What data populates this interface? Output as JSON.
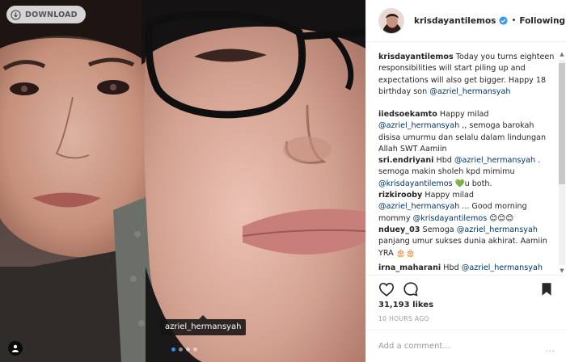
{
  "photo": {
    "download_label": "DOWNLOAD",
    "tag_username": "azriel_hermansyah",
    "carousel": {
      "count": 4,
      "active": 1
    }
  },
  "header": {
    "username": "krisdayantilemos",
    "verified": true,
    "follow_status": "Following"
  },
  "comments": [
    {
      "user": "krisdayantilemos",
      "parts": [
        {
          "t": " Today you turns eighteen responsibilities will start piling up and expectations will also get bigger. Happy 18 birthday son "
        },
        {
          "m": "@azriel_hermansyah"
        }
      ]
    },
    {
      "user": "iiedsoekamto",
      "parts": [
        {
          "t": " Happy milad "
        },
        {
          "m": "@azriel_hermansyah"
        },
        {
          "t": " ,, semoga barokah disisa umurmu dan selalu dalam lindungan Allah SWT Aamiin"
        }
      ]
    },
    {
      "user": "sri.endriyani",
      "parts": [
        {
          "t": " Hbd "
        },
        {
          "m": "@azriel_hermansyah"
        },
        {
          "t": " . semoga makin sholeh kpd mimimu "
        },
        {
          "m": "@krisdayantilemos"
        },
        {
          "t": " 💚u both."
        }
      ]
    },
    {
      "user": "rizkirooby",
      "parts": [
        {
          "t": " Happy milad "
        },
        {
          "m": "@azriel_hermansyah"
        },
        {
          "t": " ... Good morning mommy "
        },
        {
          "m": "@krisdayantilemos"
        },
        {
          "t": " 😊😊😊"
        }
      ]
    },
    {
      "user": "nduey_03",
      "parts": [
        {
          "t": " Semoga "
        },
        {
          "m": "@azriel_hermansyah"
        },
        {
          "t": " panjang umur sukses dunia akhirat. Aamiin YRA 🎂🎂"
        }
      ]
    },
    {
      "user": "irna_maharani",
      "parts": [
        {
          "t": " Hbd "
        },
        {
          "m": "@azriel_hermansyah"
        }
      ]
    }
  ],
  "stats": {
    "likes": "31,193 likes",
    "time": "10 HOURS AGO"
  },
  "comment_input": {
    "placeholder": "Add a comment...",
    "more_label": "..."
  },
  "icons": {
    "download": "download-icon",
    "like": "heart-icon",
    "comment": "comment-icon",
    "save": "bookmark-icon",
    "verified": "verified-badge-icon",
    "tagged_user": "user-tag-icon"
  },
  "colors": {
    "accent_blue": "#3897f0",
    "mention": "#003569",
    "text": "#262626",
    "muted": "#999999"
  }
}
